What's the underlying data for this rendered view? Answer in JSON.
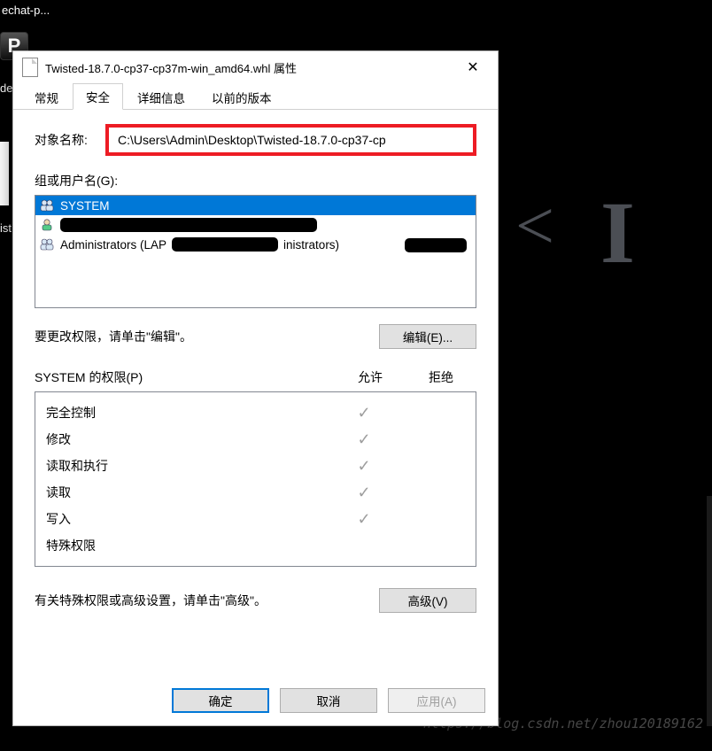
{
  "desktop": {
    "icon1_label": "echat-p...",
    "p_icon_letter": "P",
    "dex_label": "dex",
    "ist_label": "ist"
  },
  "background": {
    "less_than": "<",
    "letter_i": "I"
  },
  "watermark": "https://blog.csdn.net/zhou120189162",
  "dialog": {
    "title": "Twisted-18.7.0-cp37-cp37m-win_amd64.whl 属性",
    "tabs": {
      "general": "常规",
      "security": "安全",
      "details": "详细信息",
      "previous": "以前的版本"
    },
    "object_name_label": "对象名称:",
    "object_path": "C:\\Users\\Admin\\Desktop\\Twisted-18.7.0-cp37-cp",
    "group_label": "组或用户名(G):",
    "users": [
      {
        "name": "SYSTEM",
        "selected": true
      },
      {
        "name": "",
        "selected": false
      },
      {
        "name": "Administrators (LAP",
        "selected": false,
        "suffix": "inistrators)"
      }
    ],
    "edit_hint": "要更改权限，请单击\"编辑\"。",
    "edit_button": "编辑(E)...",
    "perm_title": "SYSTEM 的权限(P)",
    "allow_label": "允许",
    "deny_label": "拒绝",
    "permissions": [
      {
        "name": "完全控制",
        "allow": true,
        "deny": false
      },
      {
        "name": "修改",
        "allow": true,
        "deny": false
      },
      {
        "name": "读取和执行",
        "allow": true,
        "deny": false
      },
      {
        "name": "读取",
        "allow": true,
        "deny": false
      },
      {
        "name": "写入",
        "allow": true,
        "deny": false
      },
      {
        "name": "特殊权限",
        "allow": false,
        "deny": false
      }
    ],
    "adv_hint": "有关特殊权限或高级设置，请单击\"高级\"。",
    "adv_button": "高级(V)",
    "ok_button": "确定",
    "cancel_button": "取消",
    "apply_button": "应用(A)"
  }
}
